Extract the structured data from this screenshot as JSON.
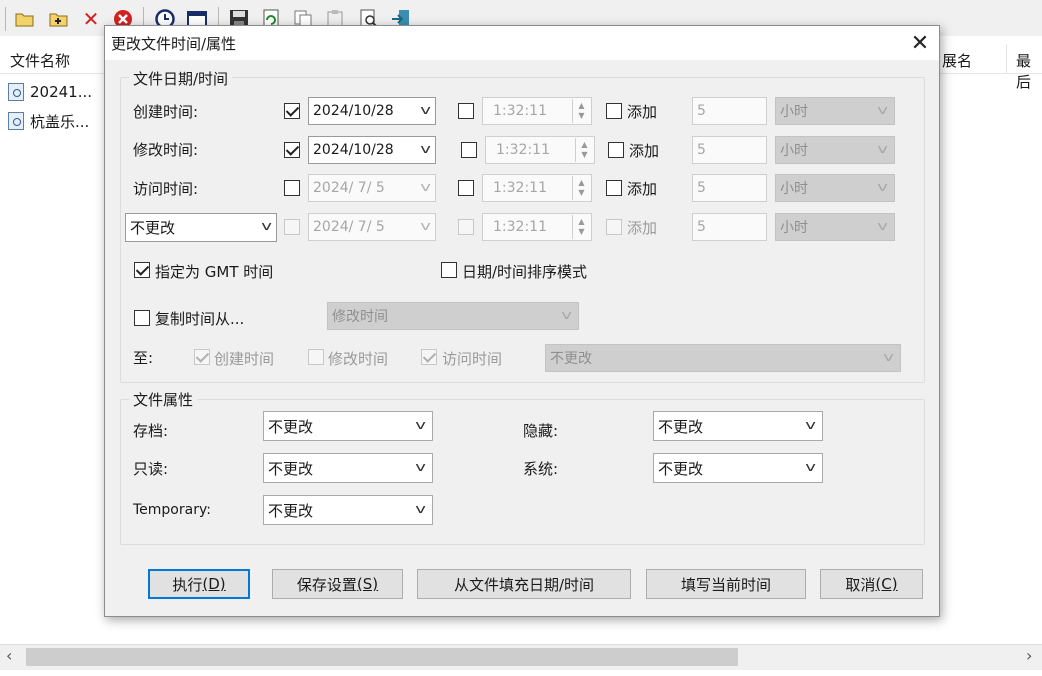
{
  "toolbar": {
    "icons": [
      "open-folder-icon",
      "add-folder-icon",
      "remove-icon",
      "delete-icon",
      "clock-icon",
      "window-icon",
      "save-icon",
      "refresh-icon",
      "copy-icon",
      "paste-icon",
      "search-file-icon",
      "exit-icon"
    ]
  },
  "list": {
    "columns": [
      "文件名称",
      "展名",
      "最后"
    ],
    "rows": [
      {
        "name": "20241..."
      },
      {
        "name": "杭盖乐..."
      }
    ]
  },
  "dialog": {
    "title": "更改文件时间/属性",
    "close_glyph": "✕",
    "datetime_group": {
      "title": "文件日期/时间",
      "rows": [
        {
          "label": "创建时间:",
          "date_checked": true,
          "date": "2024/10/28",
          "time_checked": false,
          "time": "1:32:11",
          "add_checked": false,
          "add_label": "添加",
          "add_value": "5",
          "unit": "小时"
        },
        {
          "label": "修改时间:",
          "date_checked": true,
          "date": "2024/10/28",
          "time_checked": false,
          "time": "1:32:11",
          "add_checked": false,
          "add_label": "添加",
          "add_value": "5",
          "unit": "小时"
        },
        {
          "label": "访问时间:",
          "date_checked": false,
          "date": "2024/ 7/ 5",
          "time_checked": false,
          "time": "1:32:11",
          "add_checked": false,
          "add_label": "添加",
          "add_value": "5",
          "unit": "小时"
        },
        {
          "label": "不更改",
          "date_checked": false,
          "date": "2024/ 7/ 5",
          "time_checked": false,
          "time": "1:32:11",
          "add_checked": false,
          "add_label": "添加",
          "add_value": "5",
          "unit": "小时"
        }
      ],
      "gmt_label": "指定为 GMT 时间",
      "gmt_checked": true,
      "sort_mode_label": "日期/时间排序模式",
      "sort_mode_checked": false,
      "copy_from_label": "复制时间从...",
      "copy_from_checked": false,
      "copy_from_value": "修改时间",
      "to_label": "至:",
      "to_created_label": "创建时间",
      "to_modified_label": "修改时间",
      "to_accessed_label": "访问时间",
      "to_value": "不更改"
    },
    "attr_group": {
      "title": "文件属性",
      "archive_label": "存档:",
      "archive_value": "不更改",
      "hidden_label": "隐藏:",
      "hidden_value": "不更改",
      "readonly_label": "只读:",
      "readonly_value": "不更改",
      "system_label": "系统:",
      "system_value": "不更改",
      "temporary_label": "Temporary:",
      "temporary_value": "不更改"
    },
    "buttons": {
      "execute": "执行",
      "execute_key": "(D)",
      "save_settings": "保存设置",
      "save_settings_key": "(S)",
      "fill_from_file": "从文件填充日期/时间",
      "fill_current": "填写当前时间",
      "cancel": "取消",
      "cancel_key": "(C)"
    }
  },
  "scrollbar": {
    "left_arrow": "‹",
    "right_arrow": "›"
  }
}
